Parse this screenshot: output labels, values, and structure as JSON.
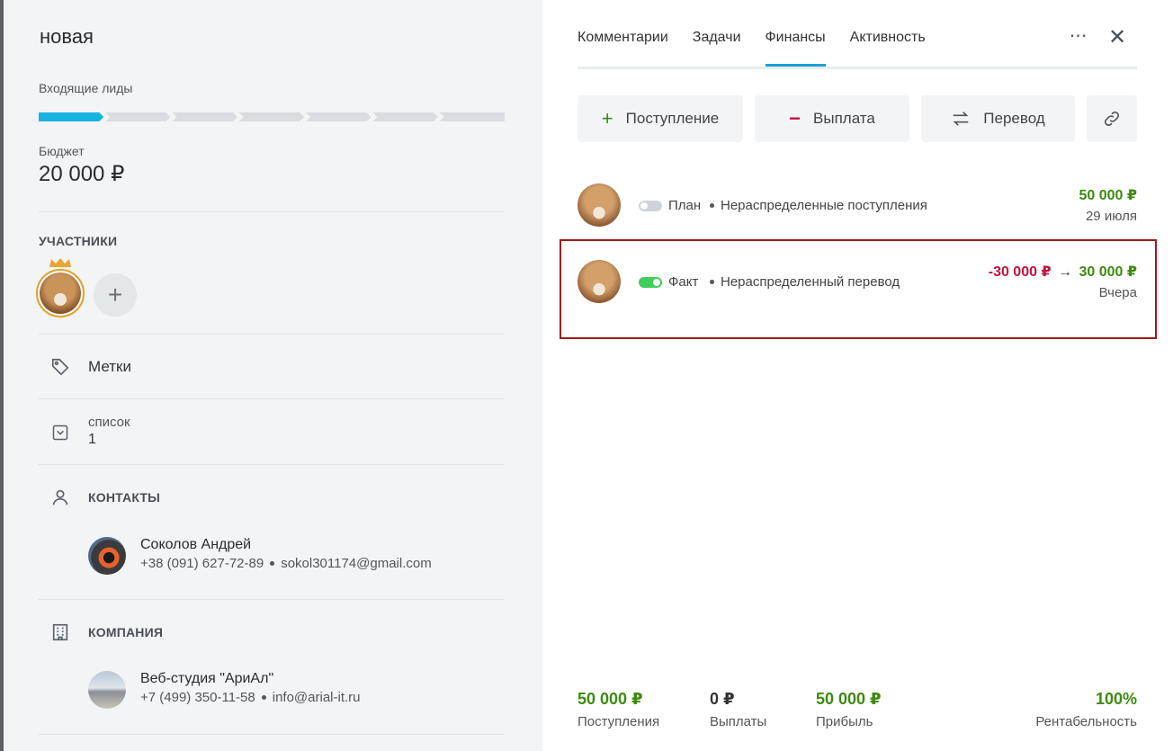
{
  "deal": {
    "status_title": "новая",
    "pipeline_label": "Входящие лиды",
    "pipeline_stages_total": 7,
    "pipeline_stage_active": 1,
    "budget_label": "Бюджет",
    "budget_value": "20 000 ₽",
    "participants_title": "УЧАСТНИКИ",
    "add_participant": "+",
    "tags_label": "Метки",
    "list_label": "список",
    "list_value": "1",
    "contacts_title": "КОНТАКТЫ",
    "contact": {
      "name": "Соколов Андрей",
      "phone": "+38 (091) 627-72-89",
      "email": "sokol301174@gmail.com"
    },
    "company_title": "КОМПАНИЯ",
    "company": {
      "name": "Веб-студия \"АриАл\"",
      "phone": "+7 (499) 350-11-58",
      "email": "info@arial-it.ru"
    }
  },
  "panel": {
    "tabs": [
      {
        "label": "Комментарии"
      },
      {
        "label": "Задачи"
      },
      {
        "label": "Финансы",
        "active": true
      },
      {
        "label": "Активность"
      }
    ],
    "more_icon": "⋯",
    "close_icon": "✕",
    "actions": {
      "income": "Поступление",
      "expense": "Выплата",
      "transfer": "Перевод"
    },
    "items": [
      {
        "type": "План",
        "desc": "Нераспределенные поступления",
        "amount": "50 000 ₽",
        "date": "29 июля",
        "toggle_on": false
      },
      {
        "type": "Факт",
        "desc": "Нераспределенный перевод",
        "amount_from": "-30 000 ₽",
        "arrow": "→",
        "amount_to": "30 000 ₽",
        "date": "Вчера",
        "toggle_on": true
      }
    ],
    "summary": {
      "income_value": "50 000 ₽",
      "income_label": "Поступления",
      "expense_value": "0 ₽",
      "expense_label": "Выплаты",
      "profit_value": "50 000 ₽",
      "profit_label": "Прибыль",
      "margin_value": "100%",
      "margin_label": "Рентабельность"
    },
    "colors": {
      "positive": "#3d8a0f",
      "negative": "#c4123f",
      "accent": "#1a9fd6",
      "highlight": "#a31818"
    }
  }
}
